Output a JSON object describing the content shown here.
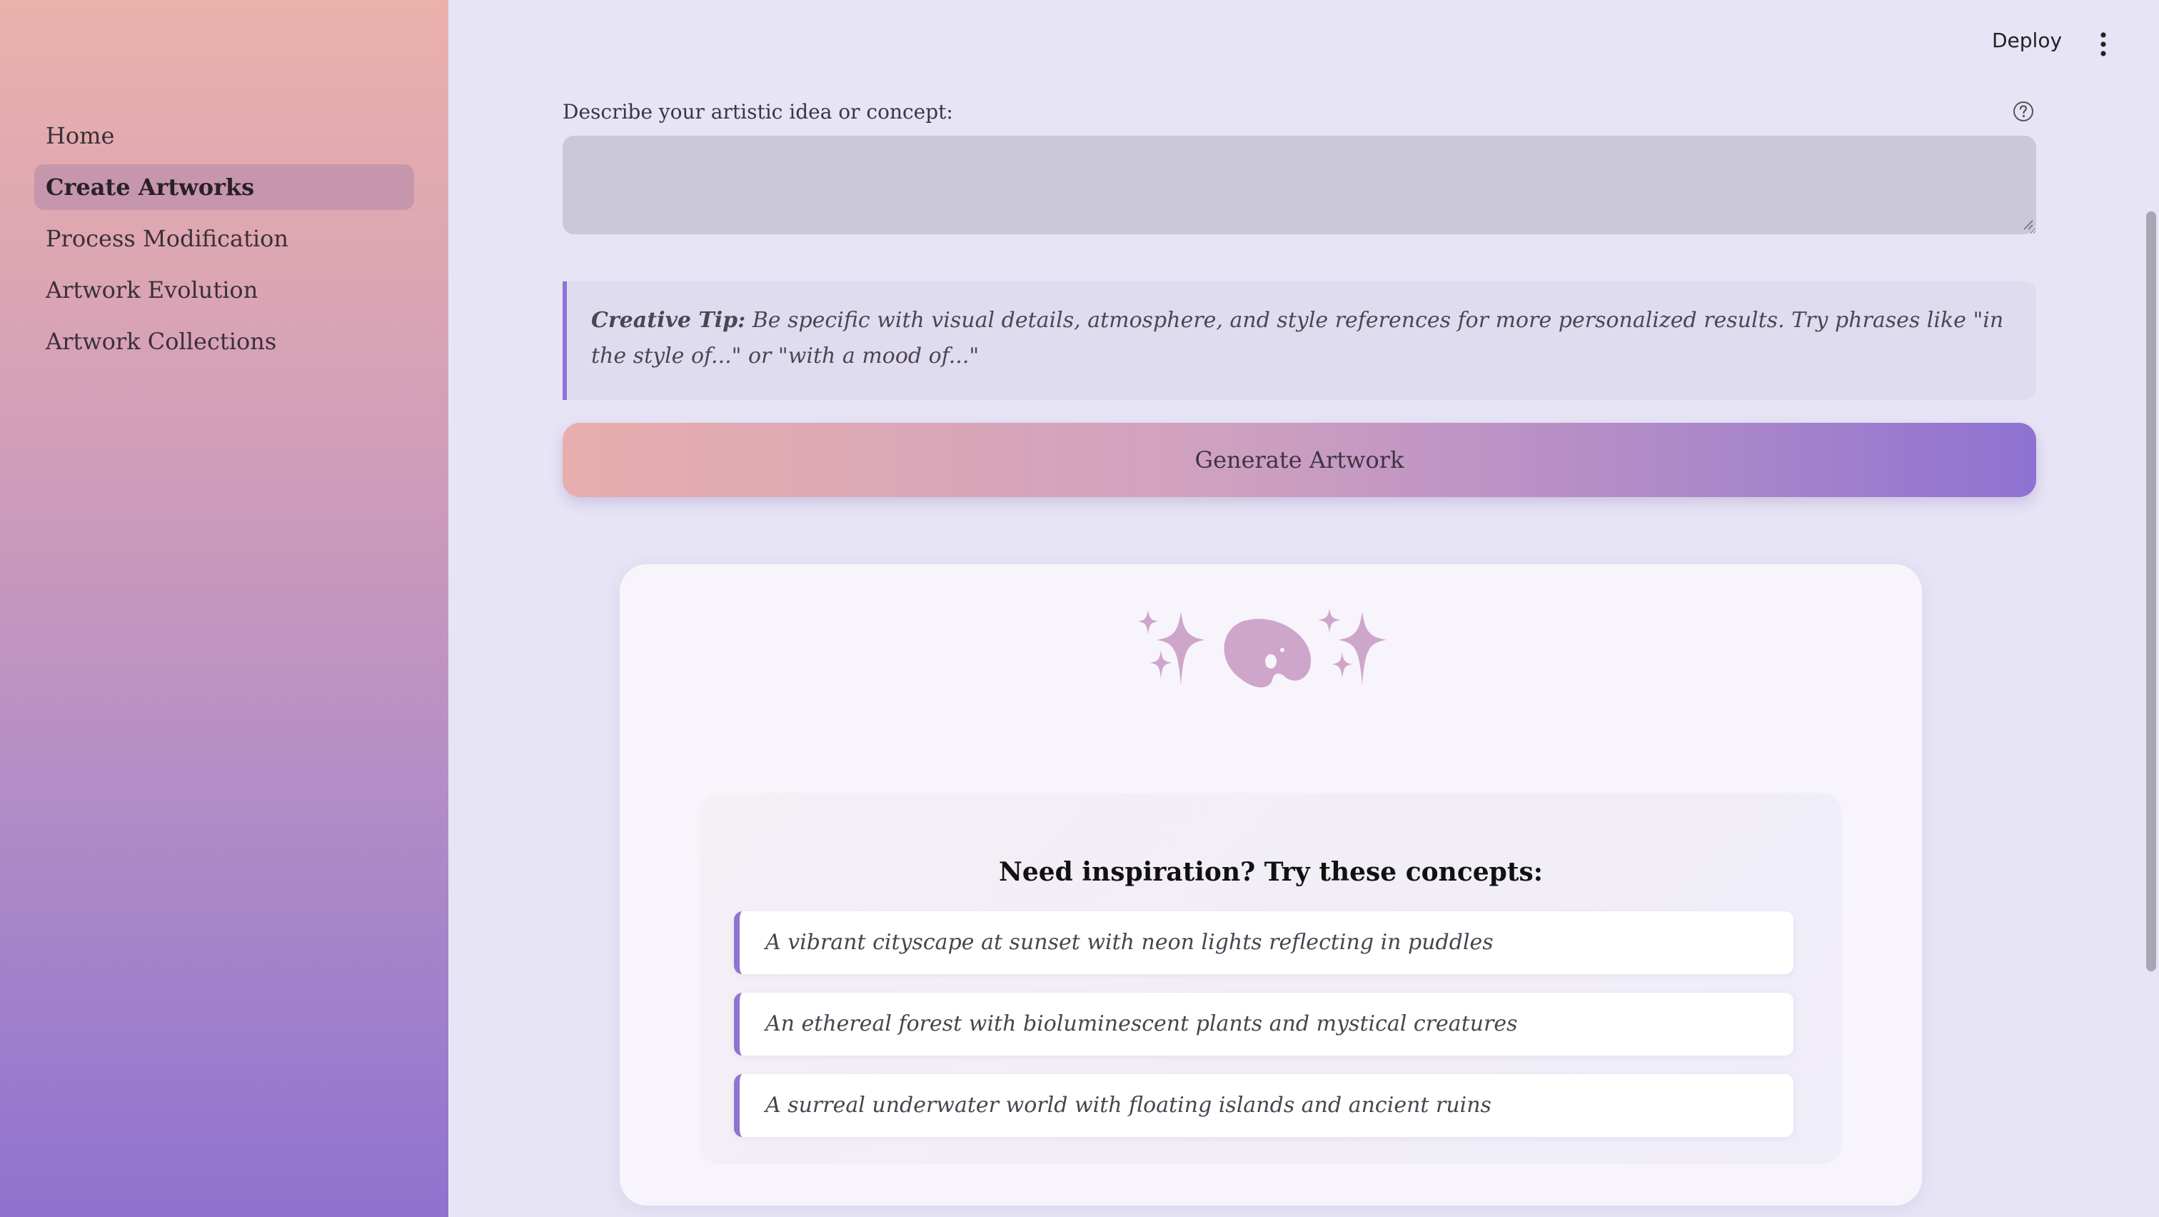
{
  "sidebar": {
    "items": [
      {
        "label": "Home"
      },
      {
        "label": "Create Artworks"
      },
      {
        "label": "Process Modification"
      },
      {
        "label": "Artwork Evolution"
      },
      {
        "label": "Artwork Collections"
      }
    ],
    "active_index": 1
  },
  "header": {
    "deploy_label": "Deploy",
    "menu_icon": "kebab-menu-icon"
  },
  "prompt": {
    "label": "Describe your artistic idea or concept:",
    "value": "",
    "help_icon": "help-icon"
  },
  "tip": {
    "heading": "Creative Tip:",
    "text": " Be specific with visual details, atmosphere, and style references for more personalized results. Try phrases like \"in the style of...\" or \"with a mood of...\""
  },
  "generate_button": {
    "label": "Generate Artwork"
  },
  "card": {
    "icons": [
      "sparkles-icon",
      "artist-palette-icon",
      "sparkles-icon"
    ],
    "inspiration": {
      "title": "Need inspiration? Try these concepts:",
      "concepts": [
        "A vibrant cityscape at sunset with neon lights reflecting in puddles",
        "An ethereal forest with bioluminescent plants and mystical creatures",
        "A surreal underwater world with floating islands and ancient ruins"
      ]
    }
  },
  "colors": {
    "accent": "#8e74d2",
    "sidebar_top": "#ebb1ab",
    "sidebar_bottom": "#8f72cf",
    "background": "#e6e4f5",
    "icon_tint": "#cfa6cb"
  }
}
